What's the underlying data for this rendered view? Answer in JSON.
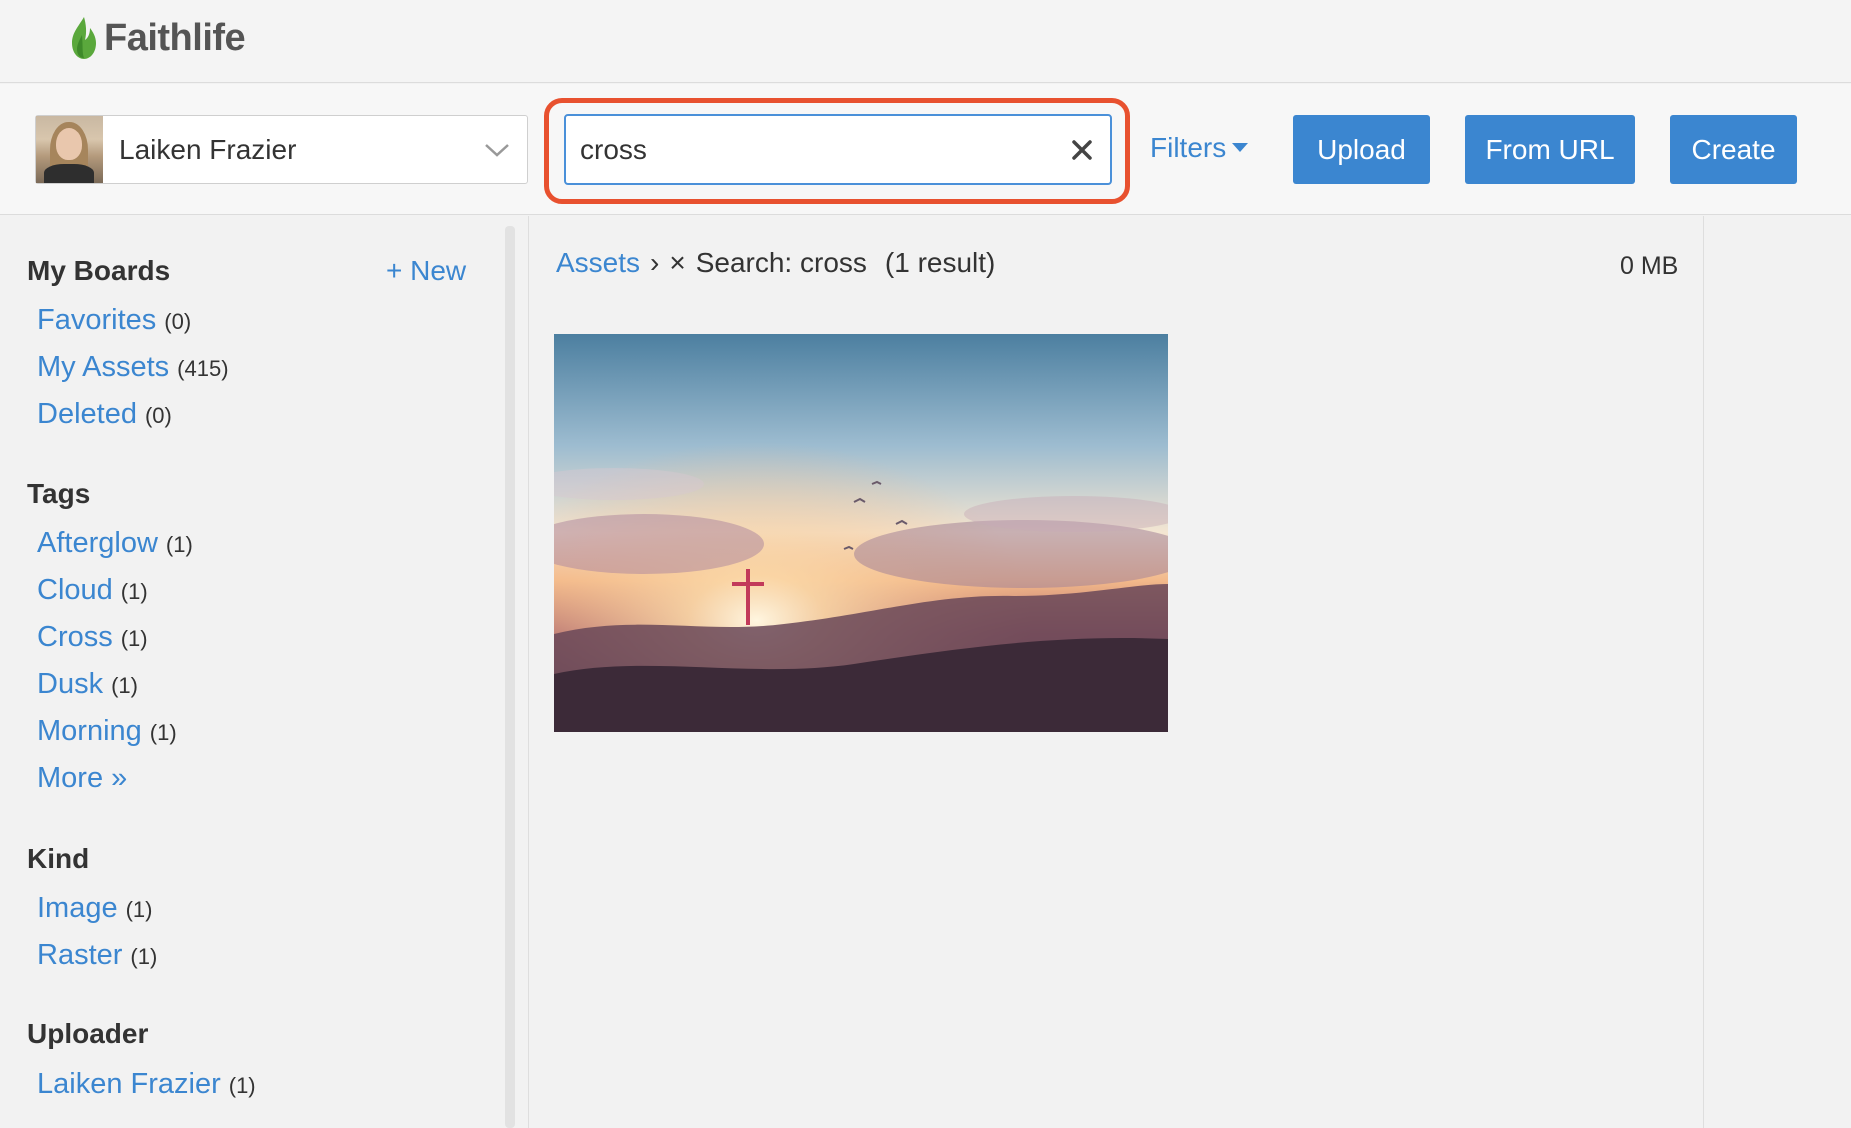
{
  "header": {
    "logo_text": "Faithlife"
  },
  "toolbar": {
    "user_name": "Laiken Frazier",
    "search_value": "cross",
    "filters_label": "Filters",
    "upload_label": "Upload",
    "from_url_label": "From URL",
    "create_label": "Create"
  },
  "sidebar": {
    "boards_title": "My Boards",
    "new_label": "+ New",
    "boards": [
      {
        "label": "Favorites",
        "count": "(0)"
      },
      {
        "label": "My Assets",
        "count": "(415)"
      },
      {
        "label": "Deleted",
        "count": "(0)"
      }
    ],
    "tags_title": "Tags",
    "tags": [
      {
        "label": "Afterglow",
        "count": "(1)"
      },
      {
        "label": "Cloud",
        "count": "(1)"
      },
      {
        "label": "Cross",
        "count": "(1)"
      },
      {
        "label": "Dusk",
        "count": "(1)"
      },
      {
        "label": "Morning",
        "count": "(1)"
      }
    ],
    "more_label": "More »",
    "kind_title": "Kind",
    "kinds": [
      {
        "label": "Image",
        "count": "(1)"
      },
      {
        "label": "Raster",
        "count": "(1)"
      }
    ],
    "uploader_title": "Uploader",
    "uploaders": [
      {
        "label": "Laiken Frazier",
        "count": "(1)"
      }
    ]
  },
  "main": {
    "crumb_assets": "Assets",
    "crumb_sep": "›",
    "crumb_clear": "×",
    "crumb_search": "Search: cross",
    "crumb_count": "(1 result)",
    "size_label": "0 MB"
  },
  "colors": {
    "accent": "#3b86d0",
    "highlight": "#e8512f"
  },
  "icons": [
    "flame-logo-icon",
    "chevron-down-icon",
    "close-icon",
    "caret-down-icon"
  ]
}
